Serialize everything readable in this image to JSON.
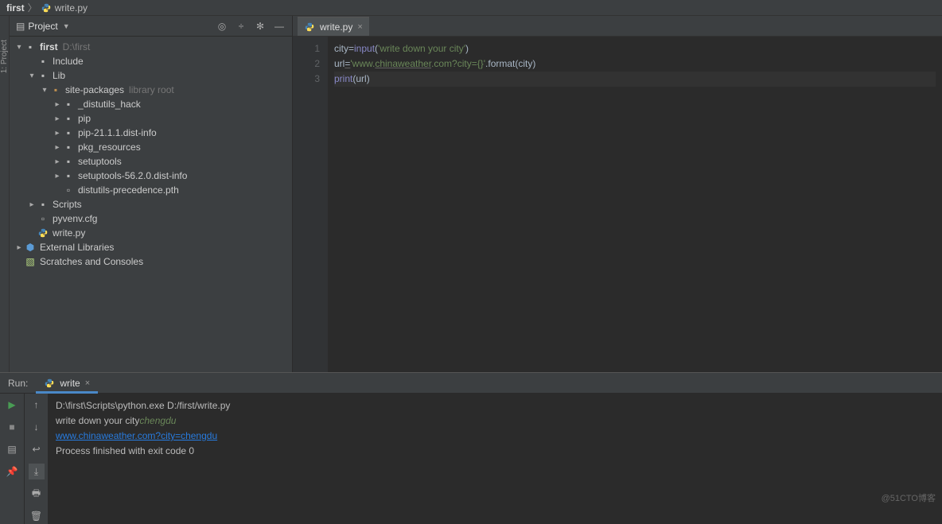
{
  "breadcrumb": {
    "root": "first",
    "file": "write.py"
  },
  "project": {
    "panel_title": "Project",
    "tree": {
      "root": {
        "name": "first",
        "path": "D:\\first"
      },
      "include": "Include",
      "lib": "Lib",
      "site_packages": {
        "name": "site-packages",
        "hint": "library root"
      },
      "distutils_hack": "_distutils_hack",
      "pip": "pip",
      "pip_dist": "pip-21.1.1.dist-info",
      "pkg_resources": "pkg_resources",
      "setuptools": "setuptools",
      "setuptools_dist": "setuptools-56.2.0.dist-info",
      "distutils_pth": "distutils-precedence.pth",
      "scripts": "Scripts",
      "pyvenv": "pyvenv.cfg",
      "writepy": "write.py",
      "ext_libs": "External Libraries",
      "scratches": "Scratches and Consoles"
    }
  },
  "editor": {
    "tab_name": "write.py",
    "lines": {
      "n1": "1",
      "n2": "2",
      "n3": "3"
    },
    "code": {
      "l1_a": "city",
      "l1_b": "=",
      "l1_c": "input",
      "l1_d": "(",
      "l1_e": "'write down your city'",
      "l1_f": ")",
      "l2_a": "url",
      "l2_b": "=",
      "l2_c": "'www.",
      "l2_d": "chinaweather",
      "l2_e": ".com?city={}'",
      "l2_f": ".format(city)",
      "l3_a": "print",
      "l3_b": "(",
      "l3_c": "url",
      "l3_d": ")"
    }
  },
  "run": {
    "label": "Run:",
    "tab": "write",
    "console": {
      "cmd": "D:\\first\\Scripts\\python.exe D:/first/write.py",
      "prompt": "write down your city",
      "user_input": "chengdu",
      "output_link": "www.chinaweather.com?city=chengdu",
      "blank": " ",
      "finished": "Process finished with exit code 0"
    }
  },
  "watermark": "@51CTO博客"
}
